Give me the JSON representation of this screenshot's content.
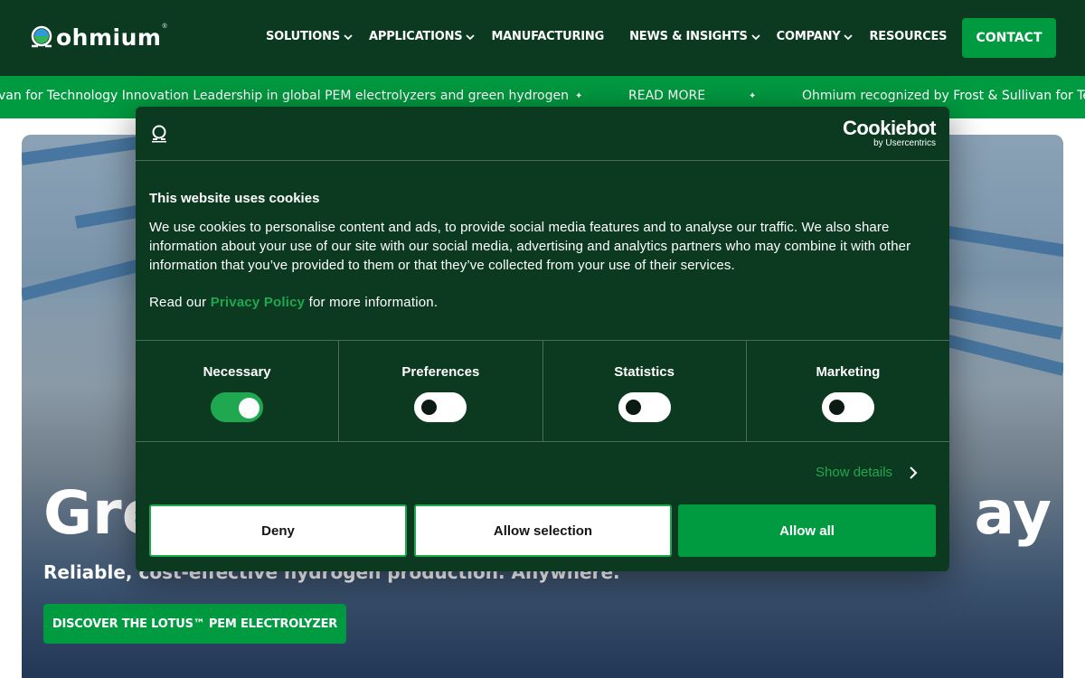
{
  "brand": {
    "name": "ohmium",
    "trademark": "®"
  },
  "nav": {
    "items": [
      {
        "label": "SOLUTIONS",
        "dropdown": true
      },
      {
        "label": "APPLICATIONS",
        "dropdown": true
      },
      {
        "label": "MANUFACTURING",
        "dropdown": false
      },
      {
        "label": "NEWS & INSIGHTS",
        "dropdown": true
      },
      {
        "label": "COMPANY",
        "dropdown": true
      },
      {
        "label": "RESOURCES",
        "dropdown": false
      }
    ],
    "contact_label": "CONTACT"
  },
  "ticker": {
    "text_1": "van for Technology Innovation Leadership in global PEM electrolyzers and green hydrogen",
    "separator": "✦",
    "read_more": "READ MORE",
    "text_2": "Ohmium recognized by Frost & Sullivan for Techn"
  },
  "hero": {
    "title_left": "Gre",
    "title_right": "ay",
    "subtitle": "Reliable, cost-effective hydrogen production. Anywhere.",
    "cta_label": "DISCOVER THE LOTUS™ PEM ELECTROLYZER"
  },
  "cookie_dialog": {
    "provider": "Cookiebot",
    "provider_by": "by Usercentrics",
    "heading": "This website uses cookies",
    "body": "We use cookies to personalise content and ads, to provide social media features and to analyse our traffic. We also share information about your use of our site with our social media, advertising and analytics partners who may combine it with other information that you’ve provided to them or that they’ve collected from your use of their services.",
    "read_prefix": "Read our",
    "privacy_link": "Privacy Policy",
    "read_suffix": "for more information.",
    "categories": [
      {
        "label": "Necessary",
        "enabled": true
      },
      {
        "label": "Preferences",
        "enabled": false
      },
      {
        "label": "Statistics",
        "enabled": false
      },
      {
        "label": "Marketing",
        "enabled": false
      }
    ],
    "show_details": "Show details",
    "deny_label": "Deny",
    "allow_selection_label": "Allow selection",
    "allow_all_label": "Allow all"
  },
  "colors": {
    "header_bg": "#0b3a21",
    "accent_green": "#009a40",
    "link_green": "#1fa84f",
    "dialog_bg": "#0b3a21"
  }
}
